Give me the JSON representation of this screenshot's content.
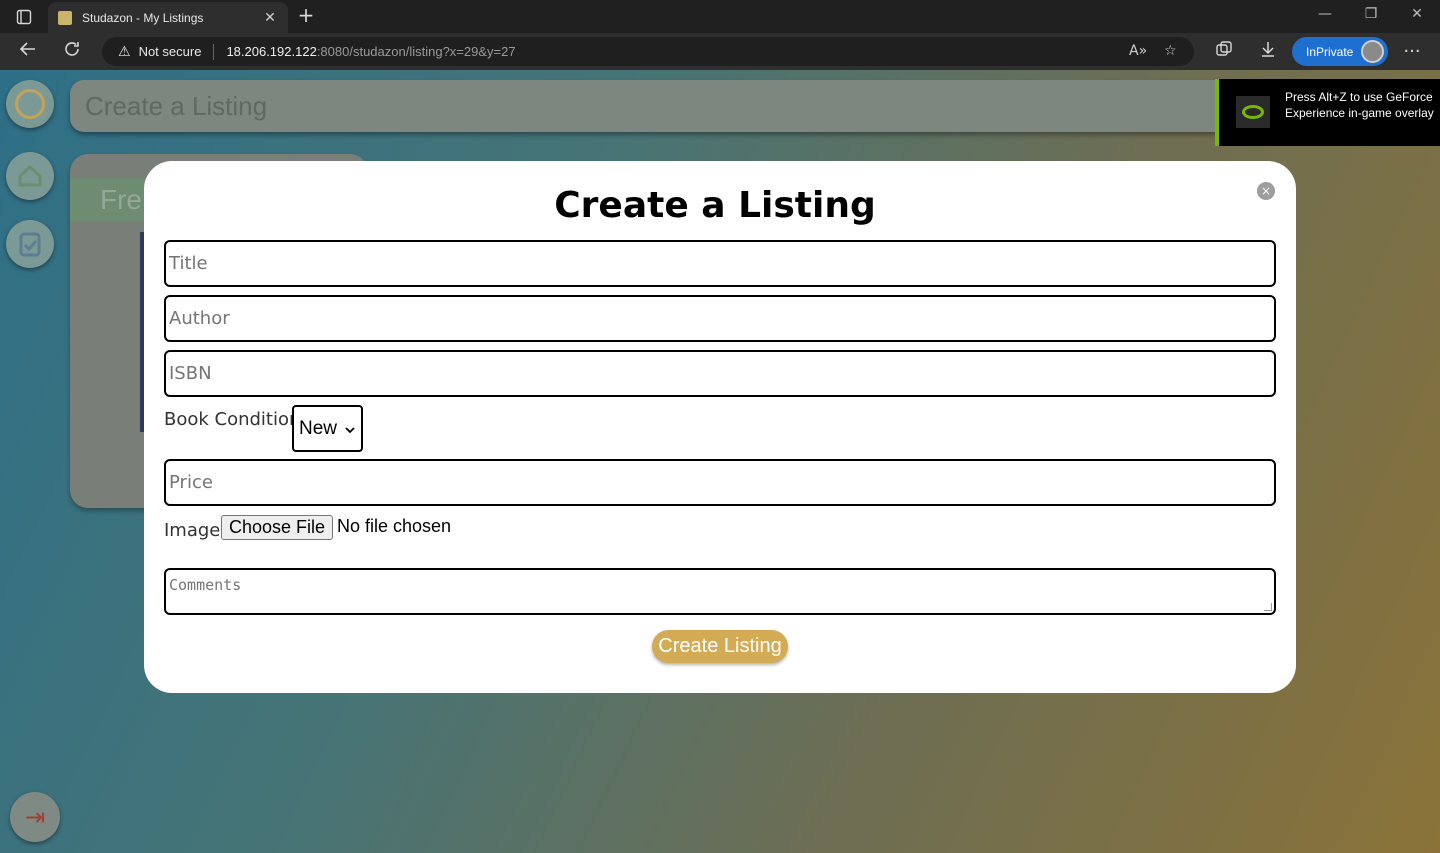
{
  "browser": {
    "tab_title": "Studazon - My Listings",
    "tab_close": "✕",
    "new_tab": "+",
    "security_label": "Not secure",
    "url_host": "18.206.192.122",
    "url_path": ":8080/studazon/listing?x=29&y=27",
    "inprivate_label": "InPrivate",
    "window_minimize": "—",
    "window_restore": "❐",
    "window_close": "✕",
    "more_menu": "···"
  },
  "page": {
    "header_title": "Create a Listing",
    "bg_card_label": "Fre",
    "colors": {
      "accent_gold": "#d4ab55",
      "nvidia_green": "#76b900",
      "inprivate_blue": "#1f6fd1"
    }
  },
  "modal": {
    "title": "Create a Listing",
    "close": "×",
    "title_placeholder": "Title",
    "author_placeholder": "Author",
    "isbn_placeholder": "ISBN",
    "condition_label": "Book Condition:",
    "condition_value": "New",
    "price_placeholder": "Price",
    "image_label": "Image:",
    "file_button": "Choose File",
    "file_status": "No file chosen",
    "comments_placeholder": "Comments",
    "submit_label": "Create Listing"
  },
  "overlay": {
    "message": "Press Alt+Z to use GeForce Experience in-game overlay"
  }
}
